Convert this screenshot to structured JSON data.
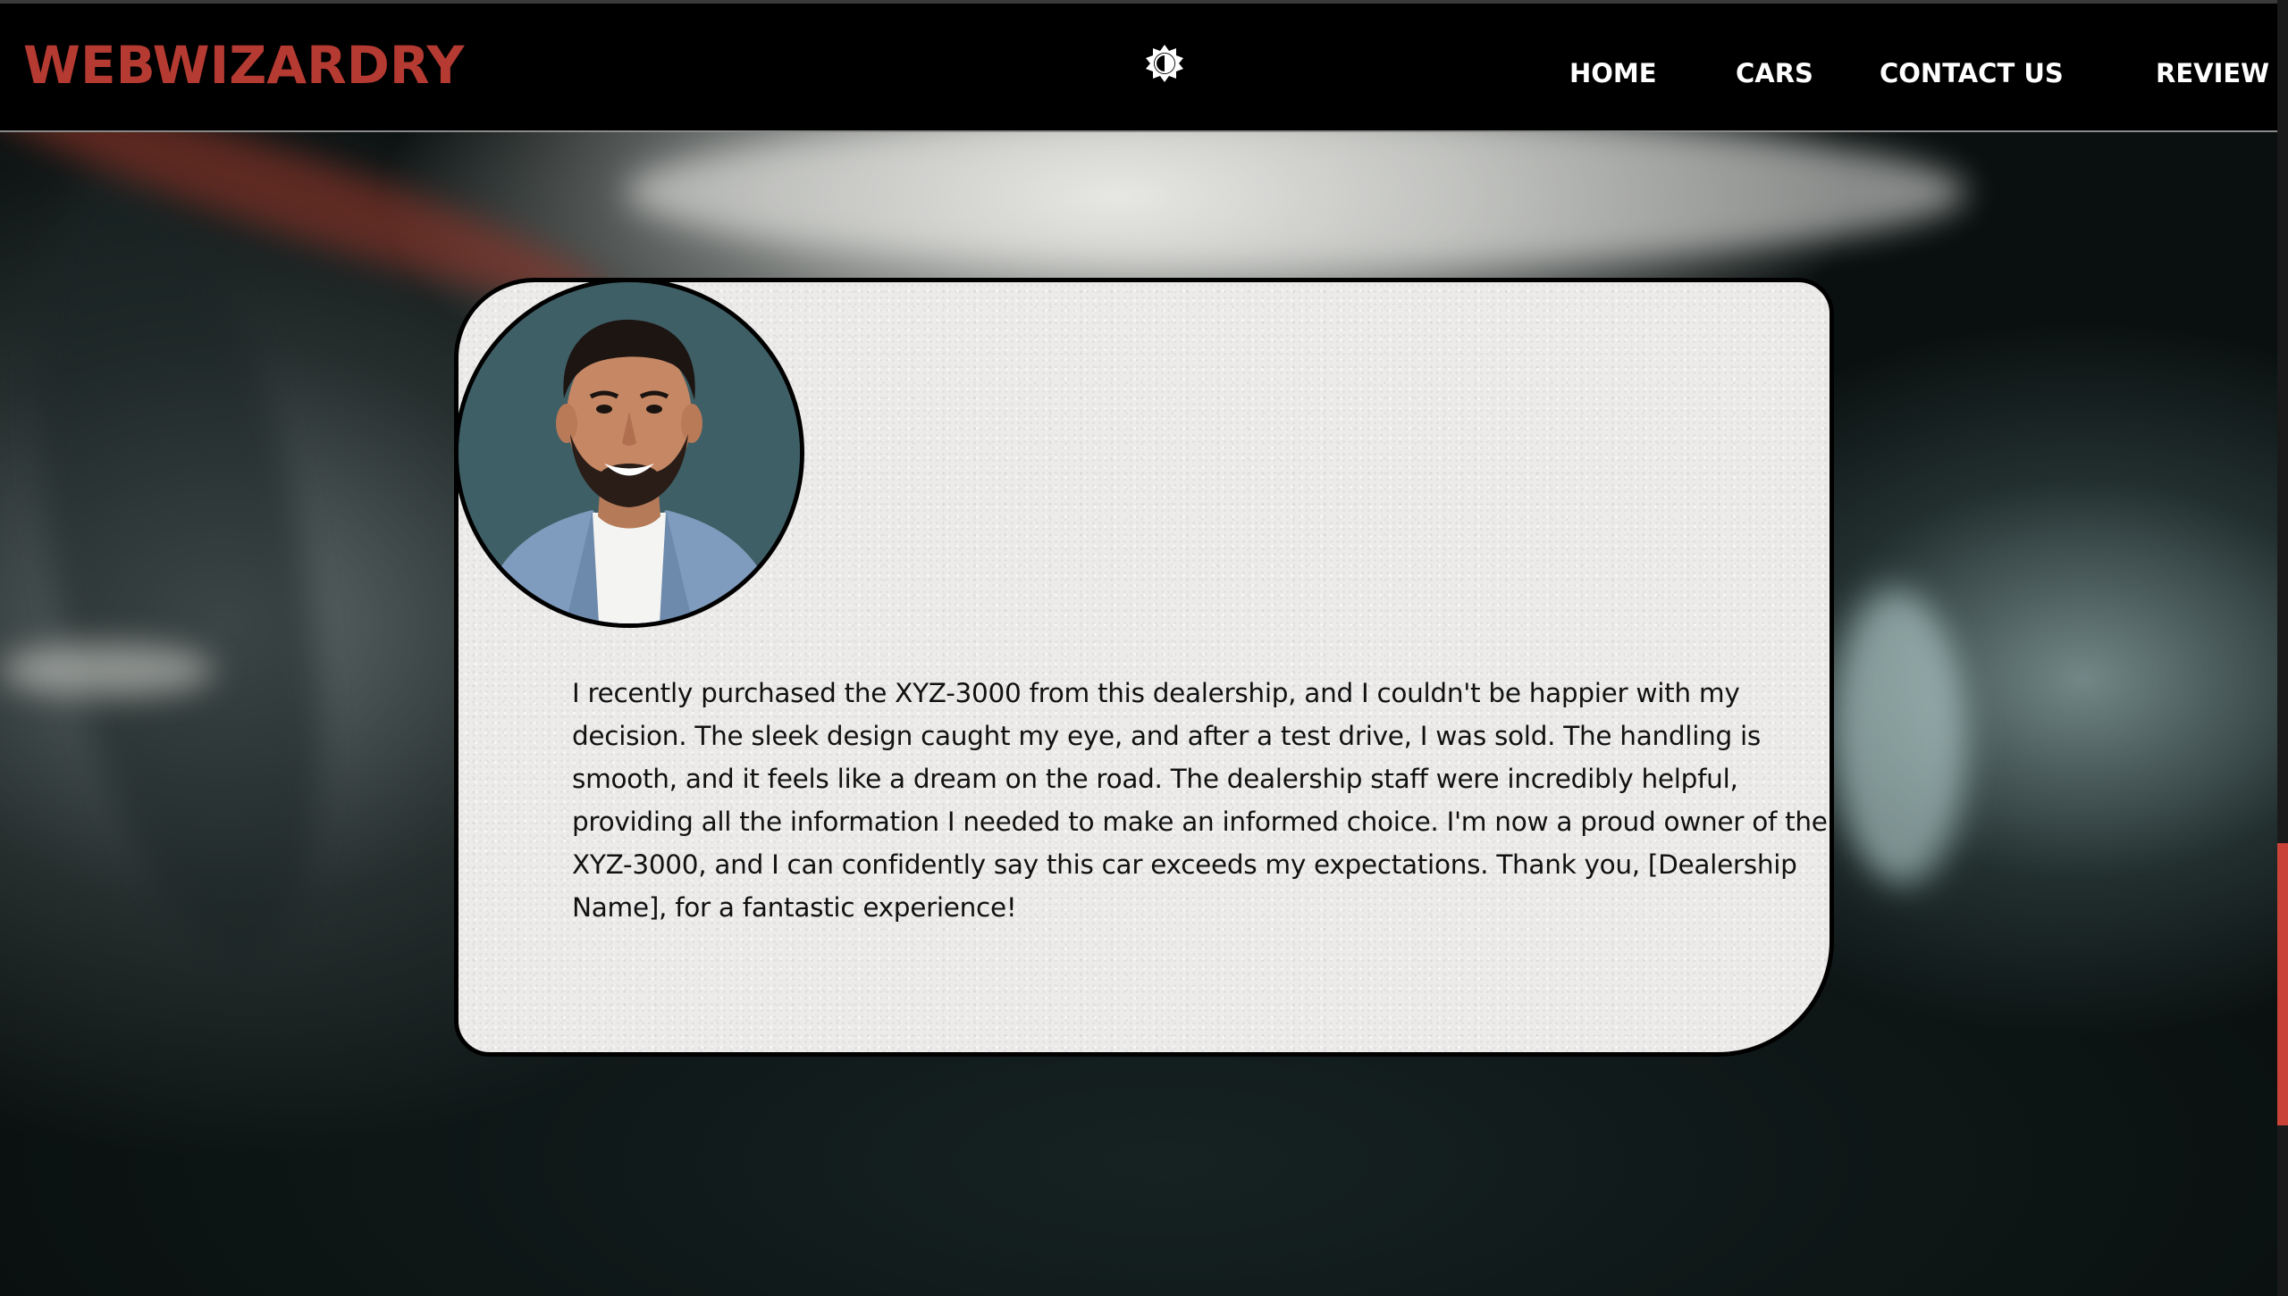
{
  "brand": {
    "name": "WEBWIZARDRY",
    "color": "#b53a32"
  },
  "header": {
    "theme_toggle_icon": "sun-moon-toggle-icon",
    "nav": {
      "home": "HOME",
      "cars": "CARS",
      "contact": "CONTACT US",
      "review": "REVIEW"
    }
  },
  "review": {
    "avatar_icon": "reviewer-portrait",
    "text": "I recently purchased the XYZ-3000 from this dealership, and I couldn't be happier with my decision. The sleek design caught my eye, and after a test drive, I was sold. The handling is smooth, and it feels like a dream on the road. The dealership staff were incredibly helpful, providing all the information I needed to make an informed choice. I'm now a proud owner of the XYZ-3000, and I can confidently say this car exceeds my expectations. Thank you, [Dealership Name], for a fantastic experience!"
  },
  "colors": {
    "navbar_bg": "#000000",
    "card_bg": "#ecebea",
    "scroll_thumb": "#c94339"
  }
}
